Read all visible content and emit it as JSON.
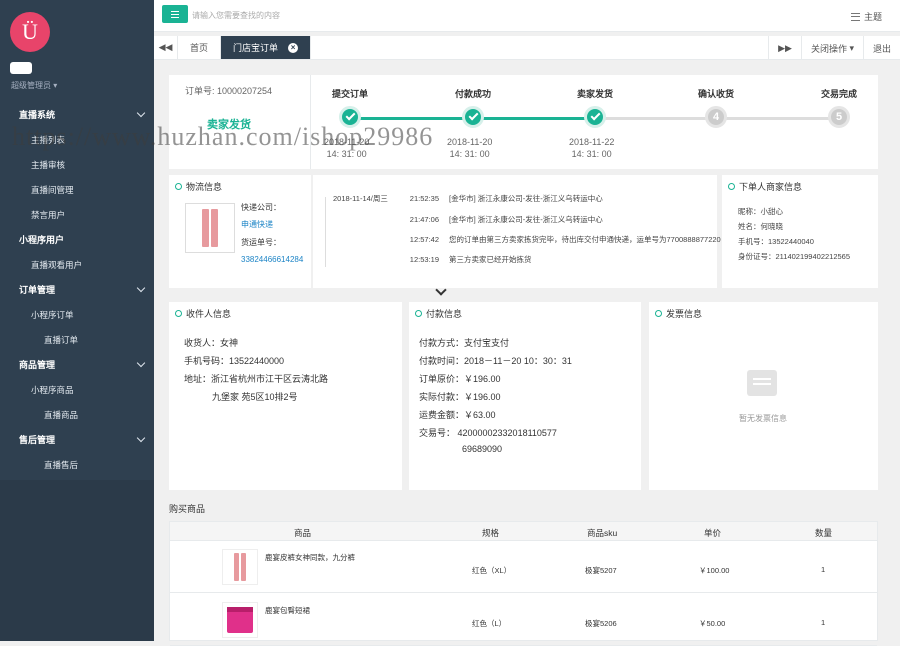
{
  "sidebar": {
    "admin": "超级管理员",
    "menu": [
      {
        "label": "直播系统",
        "children": [
          "主播列表",
          "主播审核",
          "直播间管理",
          "禁言用户"
        ]
      },
      {
        "label": "小程序用户",
        "children": [
          "直播观看用户"
        ]
      },
      {
        "label": "订单管理",
        "children": [
          "小程序订单",
          "直播订单"
        ]
      },
      {
        "label": "商品管理",
        "children": [
          "小程序商品",
          "直播商品"
        ]
      },
      {
        "label": "售后管理",
        "children": [
          "直播售后"
        ]
      }
    ]
  },
  "topbar": {
    "search_placeholder": "请输入您需要查找的内容",
    "theme": "主题"
  },
  "tabs": {
    "home": "首页",
    "active": "门店宝订单",
    "close_ops": "关闭操作",
    "logout": "退出"
  },
  "order": {
    "number_label": "订单号: 10000207254",
    "state": "卖家发货",
    "steps": [
      {
        "label": "提交订单",
        "num": "",
        "done": true,
        "date": "2018-11-20",
        "time": "14: 31: 00"
      },
      {
        "label": "付款成功",
        "num": "",
        "done": true,
        "date": "2018-11-20",
        "time": "14: 31: 00"
      },
      {
        "label": "卖家发货",
        "num": "",
        "done": true,
        "date": "2018-11-22",
        "time": "14: 31: 00"
      },
      {
        "label": "确认收货",
        "num": "4",
        "done": false,
        "date": "",
        "time": ""
      },
      {
        "label": "交易完成",
        "num": "5",
        "done": false,
        "date": "",
        "time": ""
      }
    ]
  },
  "logistics": {
    "title": "物流信息",
    "company_label": "快递公司：",
    "company": "申通快递",
    "tracking_label": "货运单号：",
    "tracking_no": "33824466614284",
    "events": [
      {
        "date": "2018-11-14/周三",
        "time": "21:52:35",
        "text": "[金华市] 浙江永康公司-发往-浙江义乌转运中心"
      },
      {
        "date": "",
        "time": "21:47:06",
        "text": "[金华市] 浙江永康公司-发往-浙江义乌转运中心"
      },
      {
        "date": "",
        "time": "12:57:42",
        "text": "您的订单由第三方卖家拣货完毕，待出库交付申通快递，运单号为7700888877220"
      },
      {
        "date": "",
        "time": "12:53:19",
        "text": "第三方卖家已经开始拣货"
      }
    ]
  },
  "buyer": {
    "title": "下单人商家信息",
    "nickname": "昵称：小甜心",
    "name": "姓名：何晓晓",
    "phone": "手机号：13522440040",
    "id_card": "身份证号：211402199402212565"
  },
  "receiver": {
    "title": "收件人信息",
    "name": "收货人：女神",
    "phone": "手机号码：13522440000",
    "address_1": "地址：浙江省杭州市江干区云涛北路",
    "address_2": "九堡家 苑5区10排2号"
  },
  "payment": {
    "title": "付款信息",
    "method": "付款方式：支付宝支付",
    "time": "付款时间：2018－11－20  10：30：31",
    "original": "订单原价：￥196.00",
    "actual": "实际付款：￥196.00",
    "shipping": "运费金额：￥63.00",
    "trade_no_1": "交易号：   42000002332018110577",
    "trade_no_2": "69689090"
  },
  "invoice": {
    "title": "发票信息",
    "empty": "暂无发票信息"
  },
  "goods": {
    "section_title": "购买商品",
    "headers": [
      "商品",
      "规格",
      "商品sku",
      "单价",
      "数量"
    ],
    "rows": [
      {
        "name": "鹿宴皮裤女神同款，九分裤",
        "spec": "红色（XL）",
        "sku": "极宴5207",
        "price": "￥100.00",
        "qty": "1",
        "image": "pants"
      },
      {
        "name": "鹿宴包臀短裙",
        "spec": "红色（L）",
        "sku": "极宴5206",
        "price": "￥50.00",
        "qty": "1",
        "image": "skirt"
      }
    ]
  },
  "watermark": "https://www.huzhan.com/ishop29986"
}
